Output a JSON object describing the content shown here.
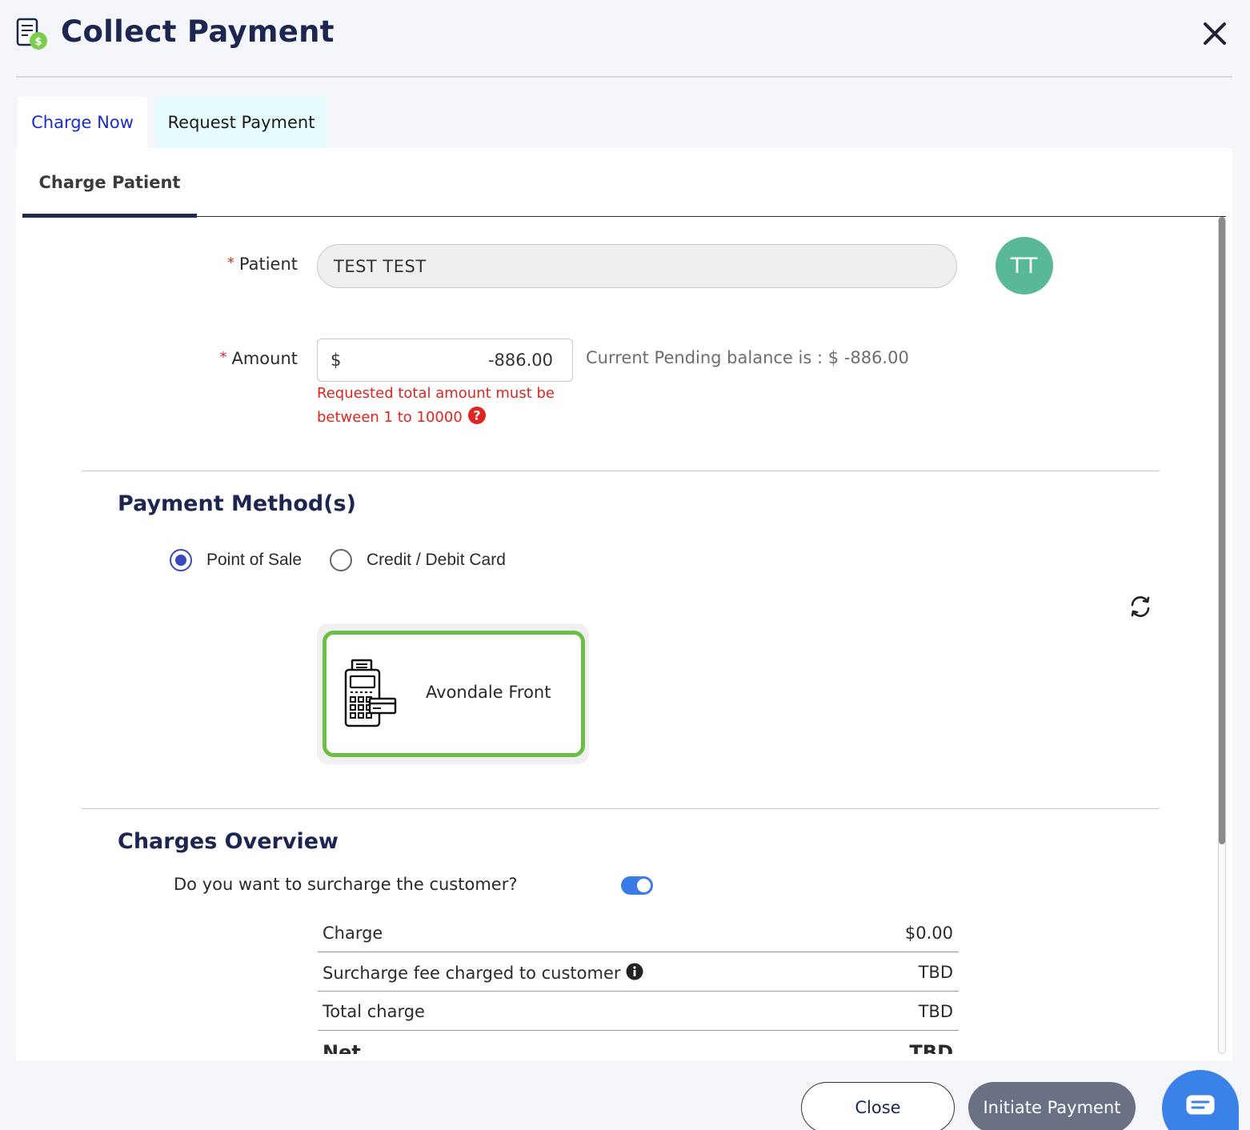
{
  "header": {
    "title": "Collect Payment"
  },
  "tabs": {
    "charge_now": "Charge Now",
    "request_payment": "Request Payment"
  },
  "subtab": {
    "label": "Charge Patient"
  },
  "patient": {
    "label": "Patient",
    "required_mark": "*",
    "value": "TEST TEST",
    "avatar_initials": "TT",
    "avatar_color": "#58b898"
  },
  "amount": {
    "label": "Amount",
    "required_mark": "*",
    "currency": "$",
    "value": "-886.00",
    "pending_text": "Current Pending balance is : $ -886.00",
    "error_text": "Requested total amount must be between 1 to 10000",
    "error_color": "#e0241f"
  },
  "payment_methods": {
    "title": "Payment Method(s)",
    "options": [
      "Point of Sale",
      "Credit / Debit Card"
    ],
    "selected": "Point of Sale",
    "device": {
      "name": "Avondale Front",
      "icon": "pos-terminal-icon",
      "border_color": "#6cbe45"
    }
  },
  "charges_overview": {
    "title": "Charges Overview",
    "surcharge_question": "Do you want to surcharge the customer?",
    "surcharge_enabled": true,
    "rows": [
      {
        "label": "Charge",
        "value": "$0.00"
      },
      {
        "label": "Surcharge fee charged to customer",
        "value": "TBD"
      },
      {
        "label": "Total charge",
        "value": "TBD"
      },
      {
        "label": "Net",
        "value": "TBD"
      }
    ]
  },
  "footer": {
    "close_label": "Close",
    "initiate_label": "Initiate Payment"
  },
  "colors": {
    "brand_navy": "#1c2650",
    "accent_blue": "#3b82e8",
    "toggle_blue": "#3b7be6"
  }
}
